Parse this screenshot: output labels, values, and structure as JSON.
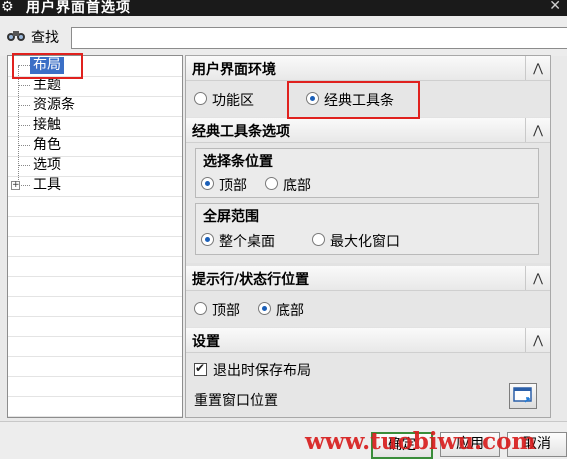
{
  "window": {
    "title": "用户界面首选项",
    "icon": "gear-icon",
    "close_glyph": "✕"
  },
  "find": {
    "icon": "binoculars-icon",
    "label": "查找",
    "value": ""
  },
  "tree": {
    "items": [
      {
        "label": "布局",
        "selected": true
      },
      {
        "label": "主题"
      },
      {
        "label": "资源条"
      },
      {
        "label": "接触"
      },
      {
        "label": "角色"
      },
      {
        "label": "选项"
      },
      {
        "label": "工具",
        "expandable": true,
        "expander": "+"
      }
    ]
  },
  "ui_env": {
    "title": "用户界面环境",
    "options": [
      {
        "label": "功能区",
        "checked": false
      },
      {
        "label": "经典工具条",
        "checked": true
      }
    ]
  },
  "classic_toolbar": {
    "title": "经典工具条选项",
    "selection_bar": {
      "title": "选择条位置",
      "options": [
        {
          "label": "顶部",
          "checked": true
        },
        {
          "label": "底部",
          "checked": false
        }
      ]
    },
    "fullscreen": {
      "title": "全屏范围",
      "options": [
        {
          "label": "整个桌面",
          "checked": true
        },
        {
          "label": "最大化窗口",
          "checked": false
        }
      ]
    }
  },
  "prompt_status": {
    "title": "提示行/状态行位置",
    "options": [
      {
        "label": "顶部",
        "checked": false
      },
      {
        "label": "底部",
        "checked": true
      }
    ]
  },
  "settings": {
    "title": "设置",
    "save_layout_label": "退出时保存布局",
    "save_layout_checked": true,
    "reset_label": "重置窗口位置"
  },
  "collapse_glyph": "⋀",
  "buttons": {
    "ok": "确定",
    "apply": "应用",
    "cancel": "取消"
  },
  "watermark": "www.tuobiwu.com",
  "colors": {
    "selection": "#3b6fc6",
    "highlight_box": "#e0211e",
    "watermark": "#d81e1e",
    "titlebar": "#1a1a1a"
  }
}
